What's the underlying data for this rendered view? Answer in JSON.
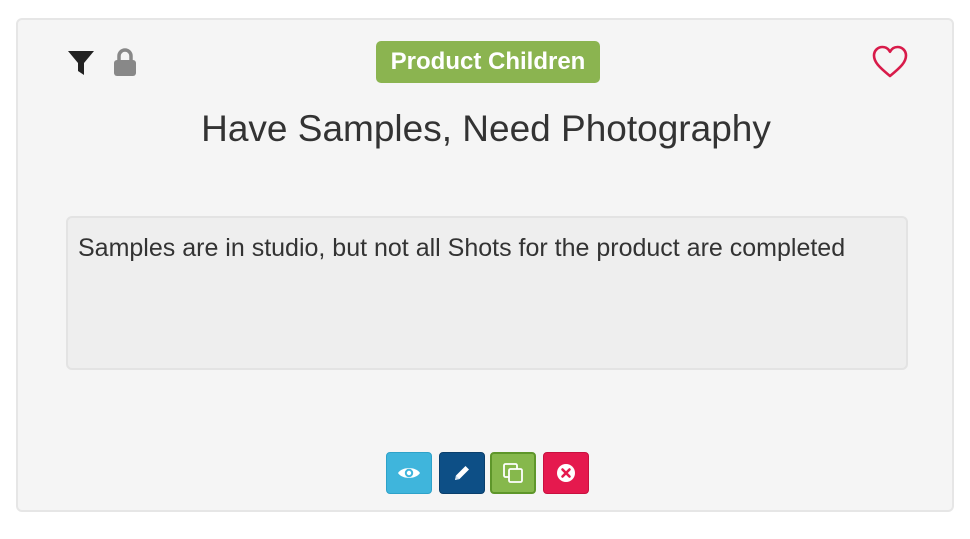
{
  "card": {
    "badge_label": "Product Children",
    "title": "Have Samples, Need Photography",
    "description": "Samples are in studio, but not all Shots for the product are completed"
  },
  "icons": {
    "filter": "filter-icon",
    "lock": "lock-icon",
    "favorite": "heart-outline-icon",
    "view": "eye-icon",
    "edit": "pencil-icon",
    "copy": "copy-icon",
    "delete": "close-circle-icon"
  },
  "colors": {
    "badge": "#8bb450",
    "favorite": "#d81b4a",
    "view_button": "#3fb5dc",
    "edit_button": "#0d4f86",
    "copy_button": "#86b84c",
    "delete_button": "#e5194e"
  }
}
